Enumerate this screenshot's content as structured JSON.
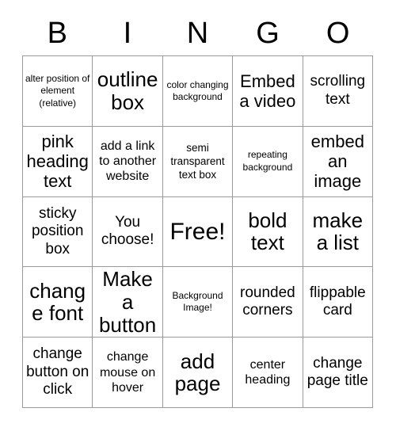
{
  "card": {
    "title_letters": [
      "B",
      "I",
      "N",
      "G",
      "O"
    ],
    "border_color": "#9a9a9a",
    "cell_background": "#ffffff",
    "text_color": "#000000"
  },
  "grid": {
    "columns": 5,
    "rows": 5,
    "cells": [
      {
        "text": "alter position of element (relative)",
        "size": "fs-xs"
      },
      {
        "text": "outline box",
        "size": "fs-xxl"
      },
      {
        "text": "color changing background",
        "size": "fs-xs"
      },
      {
        "text": "Embed a video",
        "size": "fs-xl"
      },
      {
        "text": "scrolling text",
        "size": "fs-lg"
      },
      {
        "text": "pink heading text",
        "size": "fs-xl"
      },
      {
        "text": "add a link to another website",
        "size": "fs-md"
      },
      {
        "text": "semi transparent text box",
        "size": "fs-sm"
      },
      {
        "text": "repeating background",
        "size": "fs-xs"
      },
      {
        "text": "embed an image",
        "size": "fs-xl"
      },
      {
        "text": "sticky position box",
        "size": "fs-lg"
      },
      {
        "text": "You choose!",
        "size": "fs-lg"
      },
      {
        "text": "Free!",
        "size": "fs-free"
      },
      {
        "text": "bold text",
        "size": "fs-xxl"
      },
      {
        "text": "make a list",
        "size": "fs-xxl"
      },
      {
        "text": "change font",
        "size": "fs-xxl"
      },
      {
        "text": "Make a button",
        "size": "fs-xxl"
      },
      {
        "text": "Background Image!",
        "size": "fs-xs"
      },
      {
        "text": "rounded corners",
        "size": "fs-lg"
      },
      {
        "text": "flippable card",
        "size": "fs-lg"
      },
      {
        "text": "change button on click",
        "size": "fs-lg"
      },
      {
        "text": "change mouse on hover",
        "size": "fs-md"
      },
      {
        "text": "add page",
        "size": "fs-xxl"
      },
      {
        "text": "center heading",
        "size": "fs-md"
      },
      {
        "text": "change page title",
        "size": "fs-lg"
      }
    ]
  }
}
